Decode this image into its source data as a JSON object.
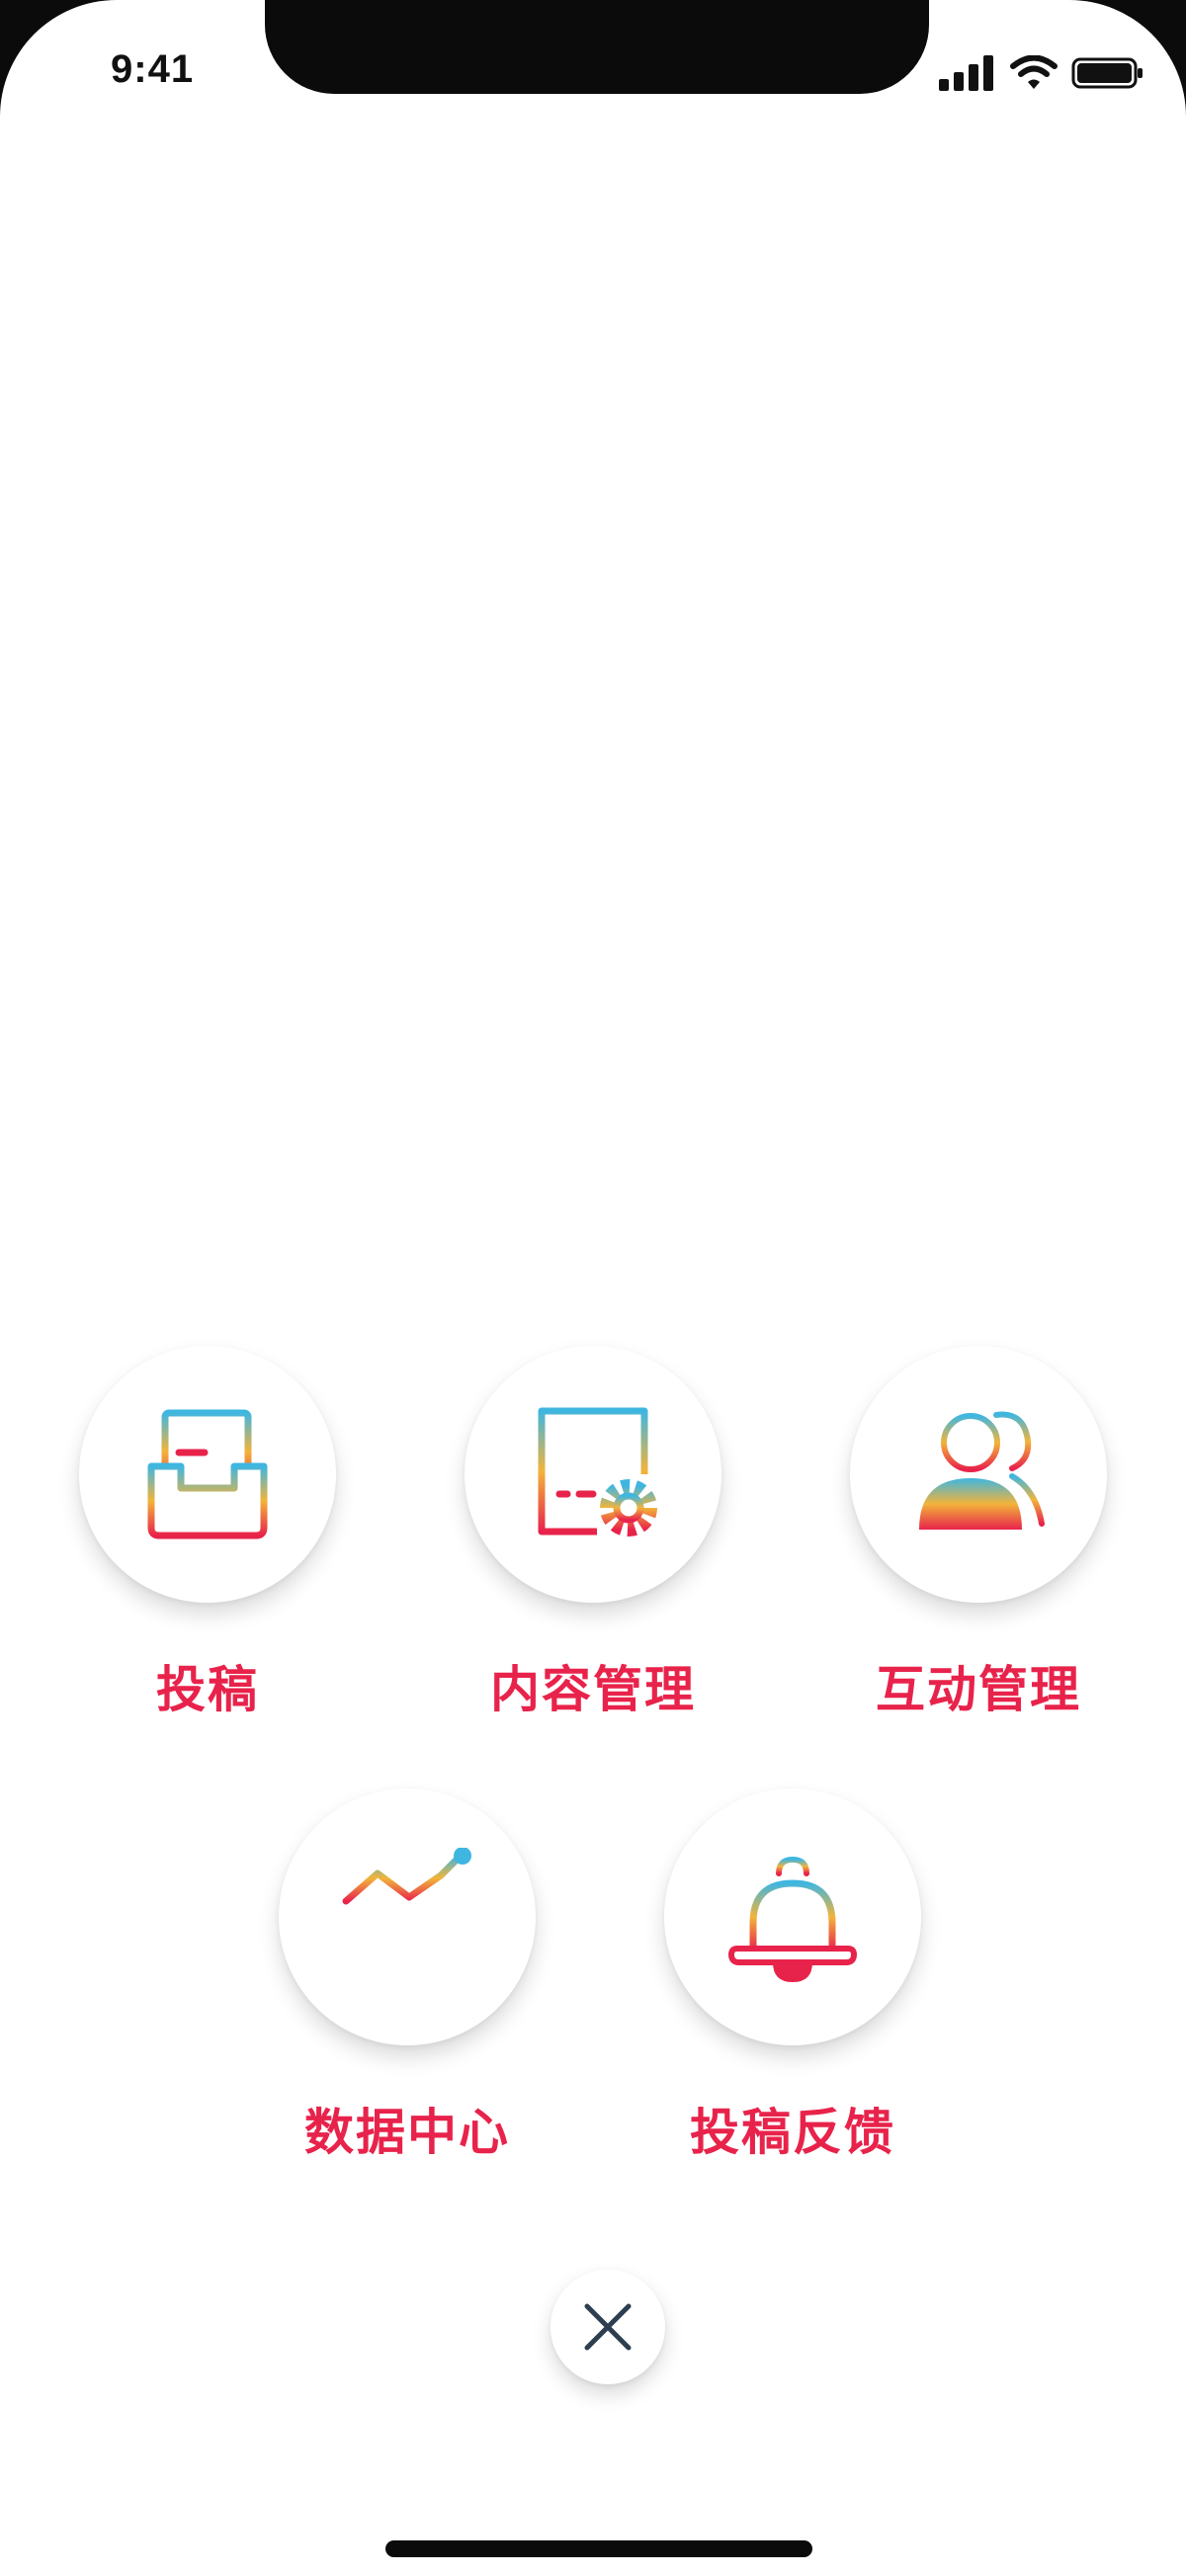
{
  "status_bar": {
    "time": "9:41",
    "icons": [
      "signal-icon",
      "wifi-icon",
      "battery-icon"
    ]
  },
  "menu": {
    "items": [
      {
        "label": "投稿",
        "icon": "inbox-tray-icon"
      },
      {
        "label": "内容管理",
        "icon": "document-settings-icon"
      },
      {
        "label": "互动管理",
        "icon": "users-icon"
      },
      {
        "label": "数据中心",
        "icon": "bar-chart-icon"
      },
      {
        "label": "投稿反馈",
        "icon": "bell-icon"
      }
    ]
  },
  "close_button": {
    "icon": "close-icon"
  },
  "colors": {
    "label": "#e8234b",
    "gradient_top": "#3fb6e0",
    "gradient_mid": "#f2b43a",
    "gradient_bottom": "#e8234b",
    "close_icon": "#2c3e50"
  }
}
